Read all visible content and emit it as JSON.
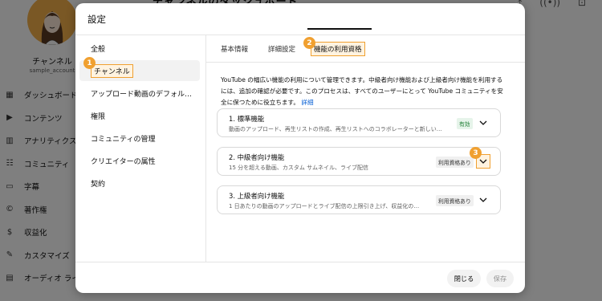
{
  "background": {
    "header_title": "チャンネルのダッシュボード",
    "channel_name": "チャンネル",
    "channel_handle": "sample_account",
    "nav": [
      {
        "label": "ダッシュボード",
        "icon": "dashboard-icon"
      },
      {
        "label": "コンテンツ",
        "icon": "content-icon"
      },
      {
        "label": "アナリティクス",
        "icon": "analytics-icon"
      },
      {
        "label": "コミュニティ",
        "icon": "community-icon"
      },
      {
        "label": "字幕",
        "icon": "subtitles-icon"
      },
      {
        "label": "著作権",
        "icon": "copyright-icon"
      },
      {
        "label": "収益化",
        "icon": "monetization-icon"
      },
      {
        "label": "カスタマイズ",
        "icon": "customization-icon"
      },
      {
        "label": "オーディオ ライ",
        "icon": "audio-library-icon"
      }
    ]
  },
  "dialog": {
    "title": "設定",
    "sidebar": [
      {
        "label": "全般"
      },
      {
        "label": "チャンネル"
      },
      {
        "label": "アップロード動画のデフォル…"
      },
      {
        "label": "権限"
      },
      {
        "label": "コミュニティの管理"
      },
      {
        "label": "クリエイターの属性"
      },
      {
        "label": "契約"
      }
    ],
    "tabs": [
      {
        "label": "基本情報"
      },
      {
        "label": "詳細設定"
      },
      {
        "label": "機能の利用資格"
      }
    ],
    "description": "YouTube の幅広い機能の利用について管理できます。中級者向け機能および上級者向け機能を利用するには、追加の確認が必要です。このプロセスは、すべてのユーザーにとって YouTube コミュニティを安全に保つために役立ちます。",
    "description_link": "詳細",
    "features": [
      {
        "title": "1. 標準機能",
        "desc": "動画のアップロード、再生リストの作成、再生リストへのコラボレーターと新しい…",
        "status": "有効"
      },
      {
        "title": "2. 中級者向け機能",
        "desc": "15 分を超える動画、カスタム サムネイル、ライブ配信",
        "status": "利用資格あり"
      },
      {
        "title": "3. 上級者向け機能",
        "desc": "1 日あたりの動画のアップロードとライブ配信の上限引き上げ、収益化の…",
        "status": "利用資格あり"
      }
    ],
    "buttons": {
      "close": "閉じる",
      "save": "保存"
    }
  },
  "markers": [
    "1",
    "2",
    "3"
  ],
  "colors": {
    "highlight": "#f0a030",
    "link": "#065fd4",
    "enabled_badge": "#1e7e34"
  }
}
